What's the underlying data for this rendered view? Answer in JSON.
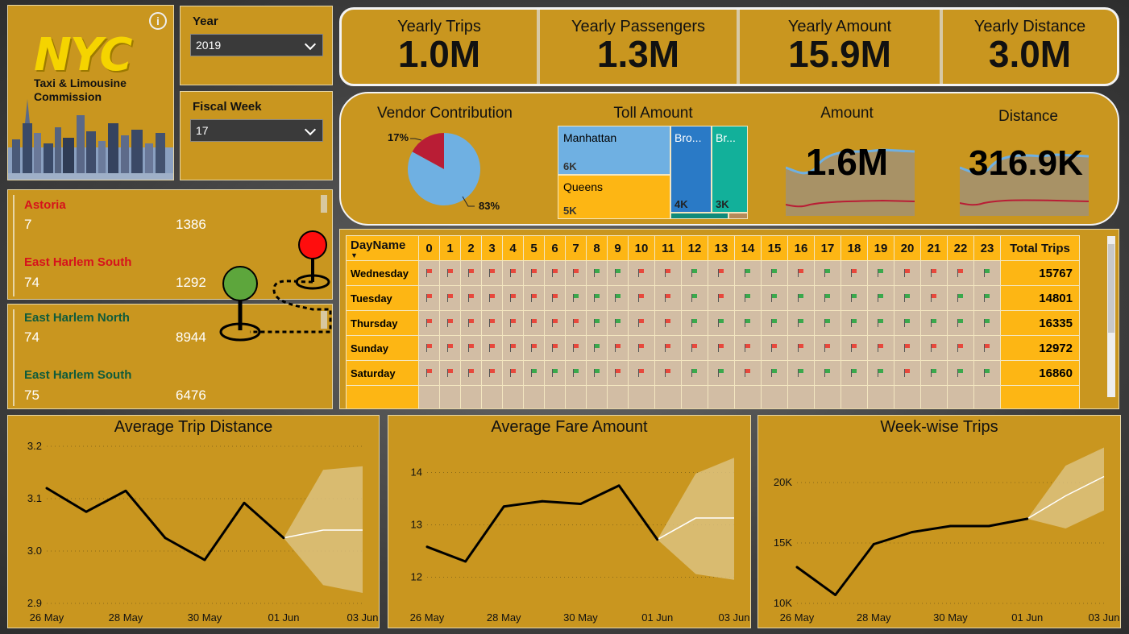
{
  "logo": {
    "brand": "NYC",
    "subtitle_line1": "Taxi & Limousine",
    "subtitle_line2": "Commission",
    "info_glyph": "i"
  },
  "slicers": {
    "year": {
      "label": "Year",
      "value": "2019"
    },
    "fiscal_week": {
      "label": "Fiscal Week",
      "value": "17"
    }
  },
  "kpis": [
    {
      "label": "Yearly Trips",
      "value": "1.0M"
    },
    {
      "label": "Yearly Passengers",
      "value": "1.3M"
    },
    {
      "label": "Yearly Amount",
      "value": "15.9M"
    },
    {
      "label": "Yearly Distance",
      "value": "3.0M"
    }
  ],
  "vendor": {
    "title": "Vendor Contribution",
    "slices": [
      {
        "label": "17%",
        "value": 17,
        "color": "#b91d35"
      },
      {
        "label": "83%",
        "value": 83,
        "color": "#6fb0e2"
      }
    ]
  },
  "toll": {
    "title": "Toll Amount",
    "tiles": [
      {
        "name": "Manhattan",
        "value": "6K",
        "color": "#6fb0e2"
      },
      {
        "name": "Queens",
        "value": "5K",
        "color": "#fdb614"
      },
      {
        "name": "Bro...",
        "value": "4K",
        "color": "#2a7ac6"
      },
      {
        "name": "Br...",
        "value": "3K",
        "color": "#12b09a"
      }
    ]
  },
  "amount_card": {
    "title": "Amount",
    "value": "1.6M"
  },
  "distance_card": {
    "title": "Distance",
    "value": "316.9K"
  },
  "locations_top": [
    {
      "name": "Astoria",
      "a": "7",
      "b": "1386",
      "color": "#d6131c"
    },
    {
      "name": "East Harlem South",
      "a": "74",
      "b": "1292",
      "color": "#d6131c"
    }
  ],
  "locations_bottom": [
    {
      "name": "East Harlem North",
      "a": "74",
      "b": "8944",
      "color": "#0f5b3b"
    },
    {
      "name": "East Harlem South",
      "a": "75",
      "b": "6476",
      "color": "#0f5b3b"
    }
  ],
  "matrix": {
    "row_header": "DayName",
    "hours": [
      "0",
      "1",
      "2",
      "3",
      "4",
      "5",
      "6",
      "7",
      "8",
      "9",
      "10",
      "11",
      "12",
      "13",
      "14",
      "15",
      "16",
      "17",
      "18",
      "19",
      "20",
      "21",
      "22",
      "23"
    ],
    "total_header": "Total Trips",
    "rows": [
      {
        "day": "Wednesday",
        "total": "15767",
        "flags": "RRRRRRRRGGRRGRGGRGRGRRRG"
      },
      {
        "day": "Tuesday",
        "total": "14801",
        "flags": "RRRRRRRGGGRRGRGGGGGGGRGG"
      },
      {
        "day": "Thursday",
        "total": "16335",
        "flags": "RRRRRRRRGGRRGGGGGGGGGGGG"
      },
      {
        "day": "Sunday",
        "total": "12972",
        "flags": "RRRRRRRRGRRRRRRRRRRRRRRR"
      },
      {
        "day": "Saturday",
        "total": "16860",
        "flags": "RRRRRGGGGRRRGGRGGGGGRGGG"
      }
    ]
  },
  "chart_data": [
    {
      "type": "line",
      "title": "Average Trip Distance",
      "x": [
        "26 May",
        "27 May",
        "28 May",
        "29 May",
        "30 May",
        "31 May",
        "01 Jun"
      ],
      "series": [
        {
          "values": [
            3.12,
            3.075,
            3.115,
            3.025,
            2.983,
            3.092,
            3.025
          ]
        }
      ],
      "forecast": {
        "x": [
          "01 Jun",
          "02 Jun",
          "03 Jun"
        ],
        "values": [
          3.025,
          3.04,
          3.04
        ],
        "upper": [
          3.025,
          3.155,
          3.162
        ],
        "lower": [
          3.025,
          2.935,
          2.92
        ]
      },
      "x_tick_labels": [
        "26 May",
        "28 May",
        "30 May",
        "01 Jun",
        "03 Jun"
      ],
      "y_ticks": [
        "2.9",
        "3.0",
        "3.1",
        "3.2"
      ],
      "ylim": [
        2.9,
        3.2
      ]
    },
    {
      "type": "line",
      "title": "Average Fare Amount",
      "x": [
        "26 May",
        "27 May",
        "28 May",
        "29 May",
        "30 May",
        "31 May",
        "01 Jun"
      ],
      "series": [
        {
          "values": [
            12.58,
            12.3,
            13.35,
            13.45,
            13.4,
            13.75,
            12.72
          ]
        }
      ],
      "forecast": {
        "x": [
          "01 Jun",
          "02 Jun",
          "03 Jun"
        ],
        "values": [
          12.72,
          13.13,
          13.13
        ],
        "upper": [
          12.72,
          13.98,
          14.28
        ],
        "lower": [
          12.72,
          12.06,
          11.95
        ]
      },
      "x_tick_labels": [
        "26 May",
        "28 May",
        "30 May",
        "01 Jun",
        "03 Jun"
      ],
      "y_ticks": [
        "12",
        "13",
        "14"
      ],
      "ylim": [
        11.5,
        14.5
      ]
    },
    {
      "type": "line",
      "title": "Week-wise Trips",
      "x": [
        "26 May",
        "27 May",
        "28 May",
        "29 May",
        "30 May",
        "31 May",
        "01 Jun"
      ],
      "series": [
        {
          "values": [
            13000,
            10700,
            14900,
            15900,
            16400,
            16400,
            17000
          ]
        }
      ],
      "forecast": {
        "x": [
          "01 Jun",
          "02 Jun",
          "03 Jun"
        ],
        "values": [
          17000,
          18900,
          20500
        ],
        "upper": [
          17000,
          21400,
          22900
        ],
        "lower": [
          17000,
          16200,
          17700
        ]
      },
      "x_tick_labels": [
        "26 May",
        "28 May",
        "30 May",
        "01 Jun",
        "03 Jun"
      ],
      "y_ticks": [
        "10K",
        "15K",
        "20K"
      ],
      "ylim": [
        10000,
        23000
      ]
    }
  ]
}
